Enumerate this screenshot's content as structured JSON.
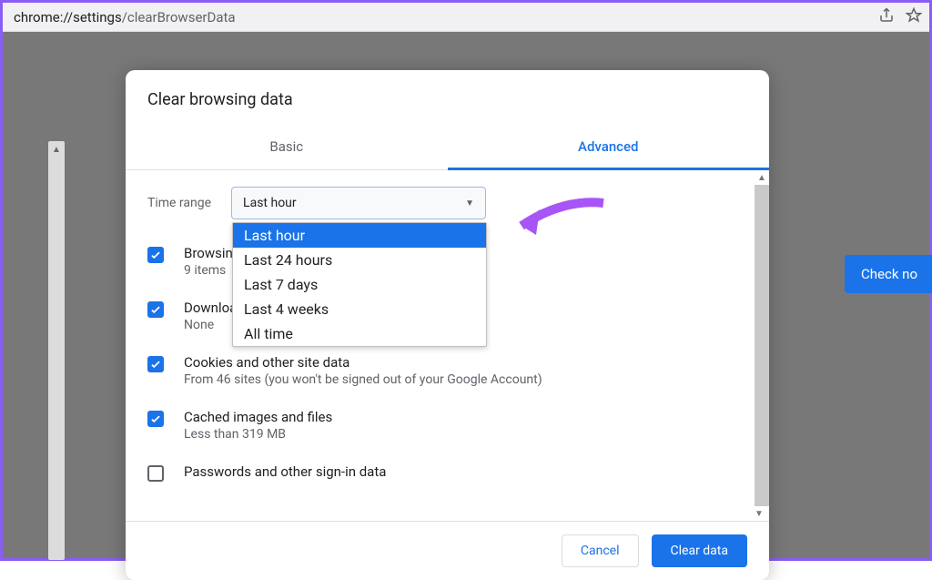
{
  "url": {
    "prefix": "chrome://",
    "mid": "settings",
    "suffix": "/clearBrowserData"
  },
  "bg": {
    "check_button": "Check no"
  },
  "modal": {
    "title": "Clear browsing data",
    "tabs": {
      "basic": "Basic",
      "advanced": "Advanced"
    },
    "time_label": "Time range",
    "time_selected": "Last hour",
    "time_options": [
      "Last hour",
      "Last 24 hours",
      "Last 7 days",
      "Last 4 weeks",
      "All time"
    ],
    "items": [
      {
        "title": "Browsing history",
        "title_visible": "Browsin",
        "sub": "9 items",
        "checked": true
      },
      {
        "title": "Download history",
        "title_visible": "Download history",
        "sub": "None",
        "checked": true
      },
      {
        "title": "Cookies and other site data",
        "sub": "From 46 sites (you won't be signed out of your Google Account)",
        "checked": true
      },
      {
        "title": "Cached images and files",
        "sub": "Less than 319 MB",
        "checked": true
      },
      {
        "title": "Passwords and other sign-in data",
        "sub": "",
        "checked": false
      }
    ],
    "cancel": "Cancel",
    "clear": "Clear data"
  }
}
